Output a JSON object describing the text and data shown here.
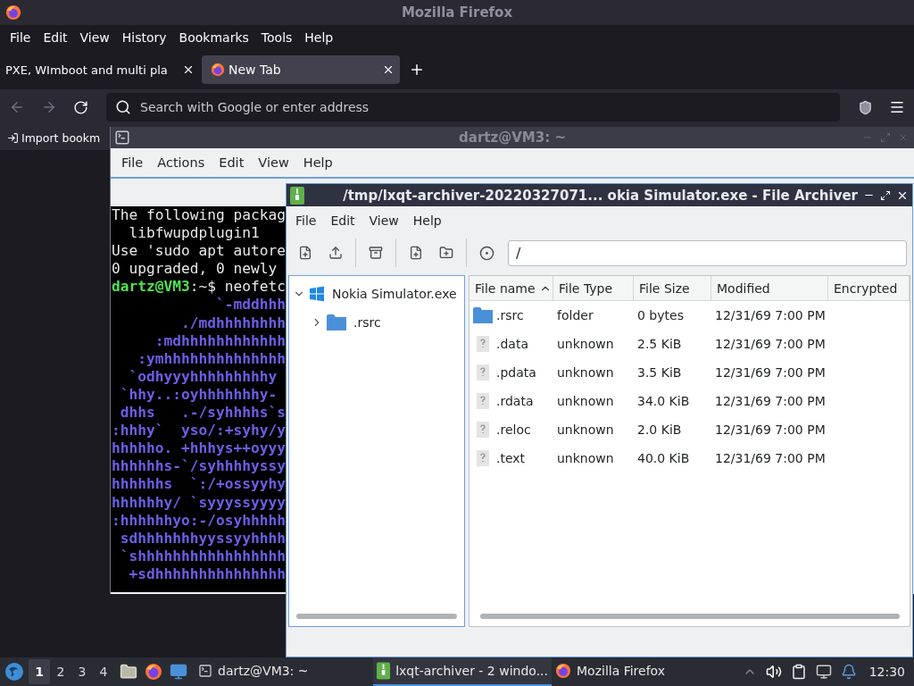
{
  "firefox": {
    "title": "Mozilla Firefox",
    "menu": [
      "File",
      "Edit",
      "View",
      "History",
      "Bookmarks",
      "Tools",
      "Help"
    ],
    "tabs": [
      {
        "label": "PXE, WImboot and multi pla",
        "selected": false
      },
      {
        "label": "New Tab",
        "selected": true
      }
    ],
    "url_placeholder": "Search with Google or enter address",
    "bookmarks": [
      "Import bookm"
    ]
  },
  "terminal": {
    "title": "dartz@VM3: ~",
    "menu": [
      "File",
      "Actions",
      "Edit",
      "View",
      "Help"
    ],
    "lines": [
      {
        "kind": "output",
        "text": "The following packag"
      },
      {
        "kind": "output",
        "text": "  libfwupdplugin1"
      },
      {
        "kind": "output",
        "text": "Use 'sudo apt autore"
      },
      {
        "kind": "output",
        "text": "0 upgraded, 0 newly"
      },
      {
        "kind": "prompt",
        "user": "dartz@VM3",
        "text": ":~$ neofetc"
      },
      {
        "kind": "art",
        "text": "            `-mddhhh"
      },
      {
        "kind": "art",
        "text": "        ./mdhhhhhhhh"
      },
      {
        "kind": "art",
        "text": "     :mdhhhhhhhhhhhh"
      },
      {
        "kind": "art",
        "text": "   :ymhhhhhhhhhhhhhh"
      },
      {
        "kind": "art",
        "text": "  `odhyyyhhhhhhhhhy"
      },
      {
        "kind": "art",
        "text": " `hhy..:oyhhhhhhhy-"
      },
      {
        "kind": "art",
        "text": " dhhs   .-/syhhhhs`s"
      },
      {
        "kind": "art",
        "text": ":hhhy`  yso/:+syhy/y"
      },
      {
        "kind": "art",
        "text": "hhhhho. +hhhys++oyyy"
      },
      {
        "kind": "art",
        "text": "hhhhhhs-`/syhhhhyssy"
      },
      {
        "kind": "art",
        "text": "hhhhhhs  `:/+ossyyhy"
      },
      {
        "kind": "art",
        "text": "hhhhhhy/ `syyyssyyyy"
      },
      {
        "kind": "art",
        "text": ":hhhhhhyo:-/osyhhhhh"
      },
      {
        "kind": "art",
        "text": " sdhhhhhhhyyssyyhhhh"
      },
      {
        "kind": "art",
        "text": " `shhhhhhhhhhhhhhhhh"
      },
      {
        "kind": "art",
        "text": "  +sdhhhhhhhhhhhhhhh"
      }
    ]
  },
  "archiver": {
    "title": "/tmp/lxqt-archiver-20220327071... okia Simulator.exe - File Archiver",
    "menu": [
      "File",
      "Edit",
      "View",
      "Help"
    ],
    "path": "/",
    "tree": [
      {
        "label": "Nokia Simulator.exe",
        "kind": "archive",
        "expanded": true,
        "children": [
          {
            "label": ".rsrc",
            "kind": "folder",
            "expanded": false
          }
        ]
      }
    ],
    "columns": [
      {
        "label": "File name",
        "sorted": true
      },
      {
        "label": "File Type",
        "sorted": false
      },
      {
        "label": "File Size",
        "sorted": false
      },
      {
        "label": "Modified",
        "sorted": false
      },
      {
        "label": "Encrypted",
        "sorted": false
      }
    ],
    "rows": [
      {
        "kind": "folder",
        "name": ".rsrc",
        "type": "folder",
        "size": "0 bytes",
        "modified": "12/31/69 7:00 PM"
      },
      {
        "kind": "file",
        "name": ".data",
        "type": "unknown",
        "size": "2.5 KiB",
        "modified": "12/31/69 7:00 PM"
      },
      {
        "kind": "file",
        "name": ".pdata",
        "type": "unknown",
        "size": "3.5 KiB",
        "modified": "12/31/69 7:00 PM"
      },
      {
        "kind": "file",
        "name": ".rdata",
        "type": "unknown",
        "size": "34.0 KiB",
        "modified": "12/31/69 7:00 PM"
      },
      {
        "kind": "file",
        "name": ".reloc",
        "type": "unknown",
        "size": "2.0 KiB",
        "modified": "12/31/69 7:00 PM"
      },
      {
        "kind": "file",
        "name": ".text",
        "type": "unknown",
        "size": "40.0 KiB",
        "modified": "12/31/69 7:00 PM"
      }
    ]
  },
  "taskbar": {
    "desktops": [
      {
        "label": "1",
        "selected": true
      },
      {
        "label": "2",
        "selected": false
      },
      {
        "label": "3",
        "selected": false
      },
      {
        "label": "4",
        "selected": false
      }
    ],
    "tasks": [
      {
        "kind": "terminal",
        "label": "dartz@VM3: ~",
        "selected": false
      },
      {
        "kind": "archiver",
        "label": "lxqt-archiver - 2 windo...",
        "selected": true
      },
      {
        "kind": "browser",
        "label": "Mozilla Firefox",
        "selected": false
      }
    ],
    "clock": "12:30"
  }
}
